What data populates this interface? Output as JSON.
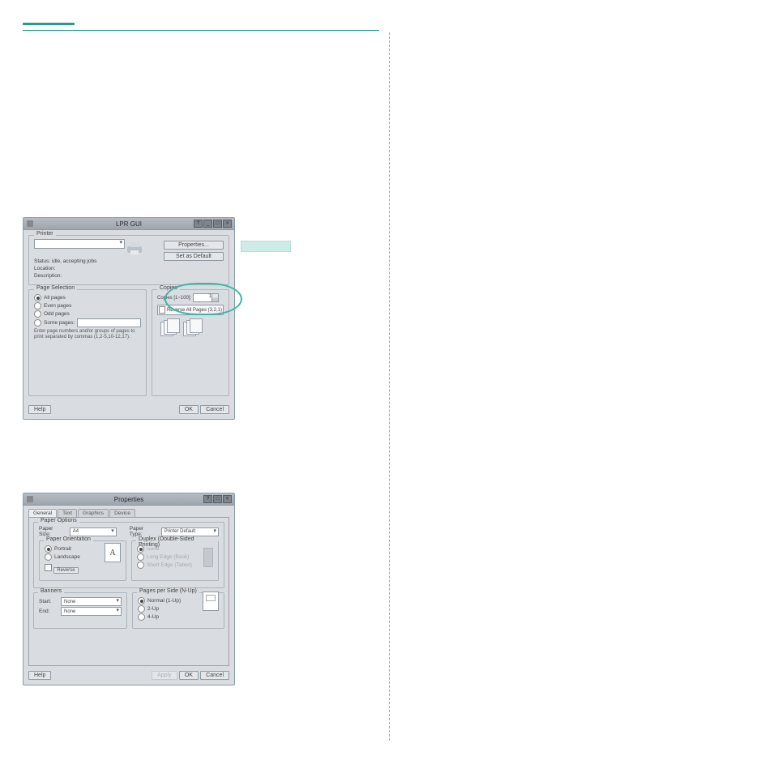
{
  "heading_rule_color": "#2a9a8e",
  "lpr_dialog": {
    "title": "LPR GUI",
    "windowed_icons": [
      "?",
      "_",
      "□",
      "×"
    ],
    "groups": {
      "printer": {
        "label": "Printer",
        "status_label": "Status:",
        "status_value": "idle, accepting jobs",
        "location_label": "Location:",
        "description_label": "Description:",
        "properties_btn": "Properties...",
        "set_default_btn": "Set as Default"
      },
      "page_selection": {
        "label": "Page Selection",
        "all_pages": "All pages",
        "even_pages": "Even pages",
        "odd_pages": "Odd pages",
        "some_pages": "Some pages:",
        "hint": "Enter page numbers and/or groups of pages to print separated by commas (1,2-5,10-12,17)."
      },
      "copies": {
        "label": "Copies",
        "copies_label": "Copies [1~100]:",
        "copies_value": "1",
        "reverse_label": "Reverse All Pages (3,2,1)"
      }
    },
    "footer": {
      "help": "Help",
      "ok": "OK",
      "cancel": "Cancel"
    }
  },
  "props_dialog": {
    "title": "Properties",
    "windowed_icons": [
      "?",
      "□",
      "×"
    ],
    "tabs": [
      "General",
      "Text",
      "Graphics",
      "Device"
    ],
    "paper_options": {
      "label": "Paper Options",
      "size_label": "Paper Size:",
      "size_value": "A4",
      "type_label": "Paper Type:",
      "type_value": "Printer Default"
    },
    "orientation": {
      "label": "Paper Orientation",
      "portrait": "Portrait",
      "landscape": "Landscape",
      "reverse_btn": "Reverse"
    },
    "duplex": {
      "label": "Duplex (Double-Sided Printing)",
      "none": "None",
      "long_edge": "Long Edge (Book)",
      "short_edge": "Short Edge (Tablet)"
    },
    "banners": {
      "label": "Banners",
      "start_label": "Start:",
      "start_value": "None",
      "end_label": "End:",
      "end_value": "None"
    },
    "nup": {
      "label": "Pages per Side (N-Up)",
      "normal": "Normal (1-Up)",
      "two": "2-Up",
      "four": "4-Up"
    },
    "footer": {
      "help": "Help",
      "apply": "Apply",
      "ok": "OK",
      "cancel": "Cancel"
    }
  }
}
